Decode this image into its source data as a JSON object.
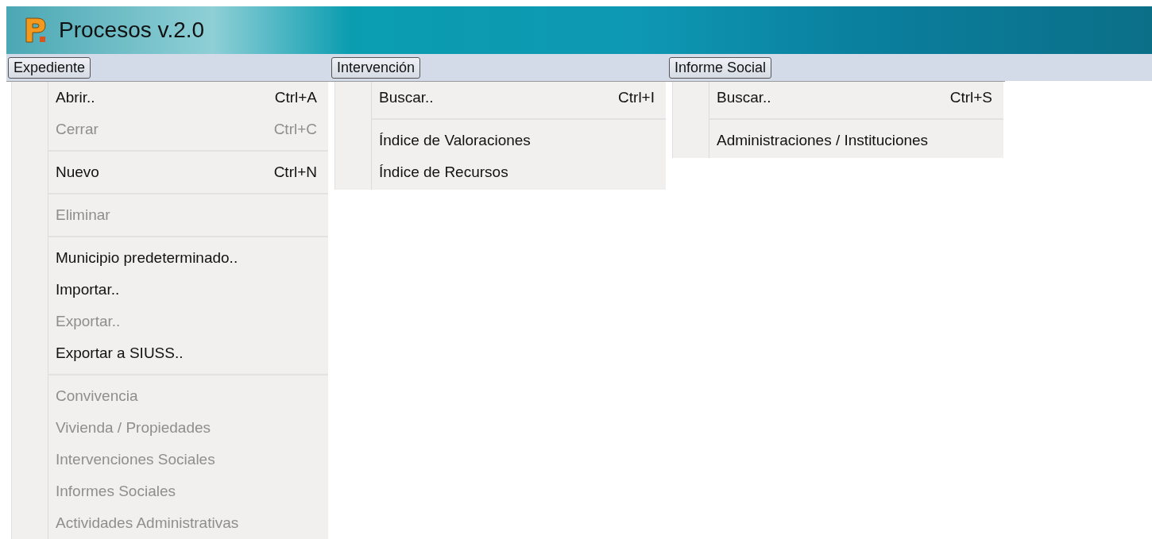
{
  "window": {
    "title": "Procesos v.2.0"
  },
  "menus": [
    {
      "title": "Expediente",
      "items": [
        {
          "kind": "item",
          "label": "Abrir..",
          "shortcut": "Ctrl+A",
          "disabled": false
        },
        {
          "kind": "item",
          "label": "Cerrar",
          "shortcut": "Ctrl+C",
          "disabled": true
        },
        {
          "kind": "separator"
        },
        {
          "kind": "item",
          "label": "Nuevo",
          "shortcut": "Ctrl+N",
          "disabled": false
        },
        {
          "kind": "separator"
        },
        {
          "kind": "item",
          "label": "Eliminar",
          "disabled": true
        },
        {
          "kind": "separator"
        },
        {
          "kind": "item",
          "label": "Municipio predeterminado..",
          "disabled": false
        },
        {
          "kind": "item",
          "label": "Importar..",
          "disabled": false
        },
        {
          "kind": "item",
          "label": "Exportar..",
          "disabled": true
        },
        {
          "kind": "item",
          "label": "Exportar a SIUSS..",
          "disabled": false
        },
        {
          "kind": "separator"
        },
        {
          "kind": "item",
          "label": "Convivencia",
          "disabled": true
        },
        {
          "kind": "item",
          "label": "Vivienda / Propiedades",
          "disabled": true
        },
        {
          "kind": "item",
          "label": "Intervenciones Sociales",
          "disabled": true
        },
        {
          "kind": "item",
          "label": "Informes Sociales",
          "disabled": true
        },
        {
          "kind": "item",
          "label": "Actividades Administrativas",
          "disabled": true
        }
      ]
    },
    {
      "title": "Intervención",
      "items": [
        {
          "kind": "item",
          "label": "Buscar..",
          "shortcut": "Ctrl+I",
          "disabled": false
        },
        {
          "kind": "separator"
        },
        {
          "kind": "item",
          "label": "Índice de Valoraciones",
          "disabled": false
        },
        {
          "kind": "item",
          "label": "Índice de Recursos",
          "disabled": false
        }
      ]
    },
    {
      "title": "Informe Social",
      "items": [
        {
          "kind": "item",
          "label": "Buscar..",
          "shortcut": "Ctrl+S",
          "disabled": false
        },
        {
          "kind": "separator"
        },
        {
          "kind": "item",
          "label": "Administraciones / Instituciones",
          "disabled": false
        }
      ]
    }
  ]
}
